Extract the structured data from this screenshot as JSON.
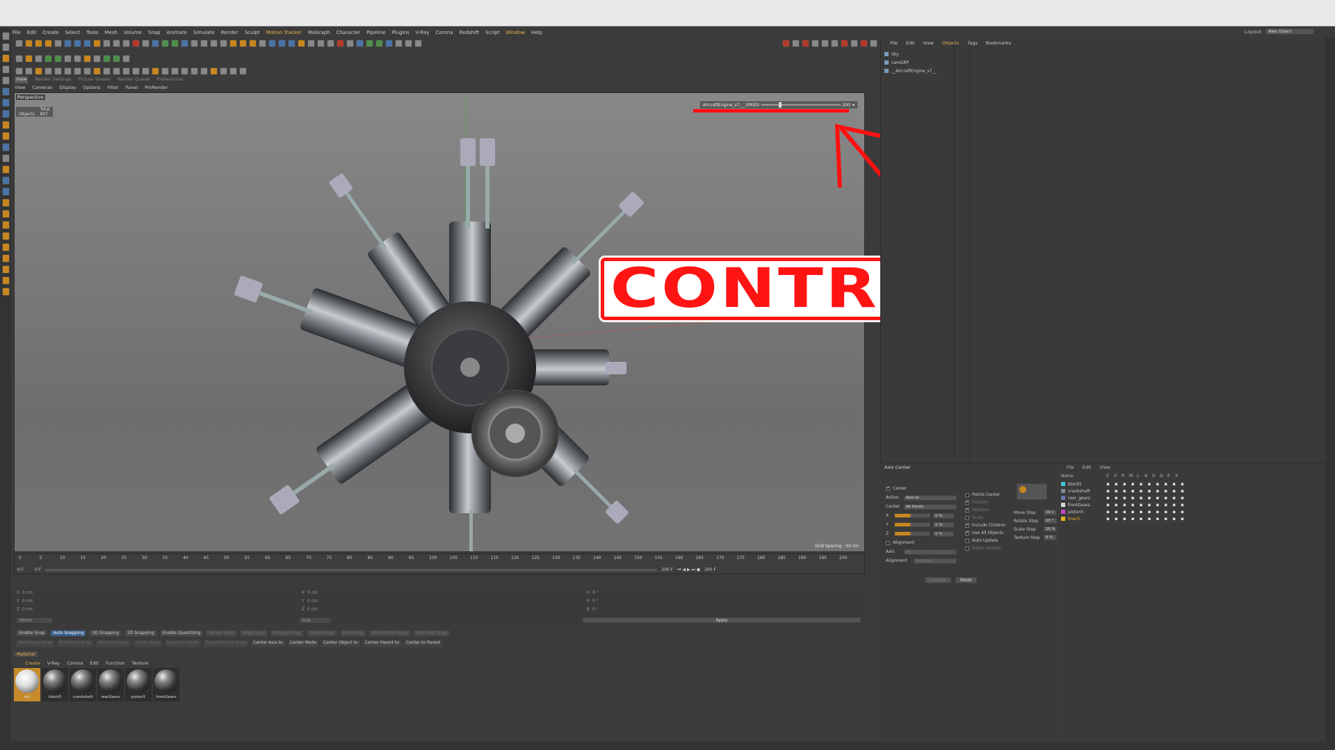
{
  "menu": [
    "File",
    "Edit",
    "Create",
    "Select",
    "Tools",
    "Mesh",
    "Volume",
    "Snap",
    "Animate",
    "Simulate",
    "Render",
    "Sculpt",
    "Motion Tracker",
    "MoGraph",
    "Character",
    "Pipeline",
    "Plugins",
    "V-Ray",
    "Corona",
    "Redshift",
    "Script",
    "Window",
    "Help"
  ],
  "layout": {
    "label": "Layout:",
    "value": "Alex (User)"
  },
  "panel_tabs": [
    "View",
    "Render Settings",
    "Picture Viewer",
    "Render Queue",
    "Preferences"
  ],
  "viewport_menu": [
    "View",
    "Cameras",
    "Display",
    "Options",
    "Filter",
    "Panel",
    "ProRender"
  ],
  "viewport": {
    "camera": "Perspective",
    "stats_header": "Total",
    "stats_label": "Objects",
    "stats_value": "807",
    "grid_spacing": "Grid Spacing : 50 cm"
  },
  "speed_control": {
    "label": "AircraftEngine_s7___SPEED",
    "value": "200"
  },
  "callout": {
    "text": "CONTROLL SPEED",
    "color": "#ff1414"
  },
  "timeline": {
    "ticks": [
      "0",
      "5",
      "10",
      "15",
      "20",
      "25",
      "30",
      "35",
      "40",
      "45",
      "50",
      "55",
      "60",
      "65",
      "70",
      "75",
      "80",
      "85",
      "90",
      "95",
      "100",
      "105",
      "110",
      "115",
      "120",
      "125",
      "130",
      "135",
      "140",
      "145",
      "150",
      "155",
      "160",
      "165",
      "170",
      "175",
      "180",
      "185",
      "190",
      "195",
      "200"
    ],
    "current_frame": "0 F",
    "start": "0 F",
    "end": "200 F",
    "end2": "200 F"
  },
  "coords": {
    "rows": [
      {
        "a": "X",
        "av": "0 cm",
        "b": "X",
        "bv": "0 cm",
        "c": "H",
        "cv": "0 °"
      },
      {
        "a": "Y",
        "av": "0 cm",
        "b": "Y",
        "bv": "0 cm",
        "c": "P",
        "cv": "0 °"
      },
      {
        "a": "Z",
        "av": "0 cm",
        "b": "Z",
        "bv": "0 cm",
        "c": "B",
        "cv": "0 °"
      }
    ],
    "mode1": "World",
    "mode2": "Size",
    "apply": "Apply"
  },
  "snap1": [
    {
      "t": "Enable Snap",
      "s": ""
    },
    {
      "t": "Auto Snapping",
      "s": "on"
    },
    {
      "t": "3D Snapping",
      "s": ""
    },
    {
      "t": "2D Snapping",
      "s": ""
    },
    {
      "t": "Enable Quantizing",
      "s": ""
    },
    {
      "t": "Vertex Snap",
      "s": "dim"
    },
    {
      "t": "Edge Snap",
      "s": "dim"
    },
    {
      "t": "Polygon Snap",
      "s": "dim"
    },
    {
      "t": "Spline Snap",
      "s": "dim"
    },
    {
      "t": "Axis Snap",
      "s": "dim"
    },
    {
      "t": "Intersection Snap",
      "s": "dim"
    },
    {
      "t": "Mid Point Snap",
      "s": "dim"
    }
  ],
  "snap2": [
    {
      "t": "Workplane Snap",
      "s": "dim"
    },
    {
      "t": "Grid Point Snap",
      "s": "dim"
    },
    {
      "t": "Grid Line Snap",
      "s": "dim"
    },
    {
      "t": "Guide Snap",
      "s": "dim"
    },
    {
      "t": "Dynamic Guide",
      "s": "dim"
    },
    {
      "t": "Perpendicular Snap",
      "s": "dim"
    },
    {
      "t": "Center Axis to",
      "s": ""
    },
    {
      "t": "Center Mode",
      "s": ""
    },
    {
      "t": "Center Object to",
      "s": ""
    },
    {
      "t": "Center Parent to",
      "s": ""
    },
    {
      "t": "Center to Parent",
      "s": ""
    }
  ],
  "material_tab": "Material",
  "material_menu": [
    "Create",
    "V-Ray",
    "Corona",
    "Edit",
    "Function",
    "Texture"
  ],
  "materials": [
    "sky",
    "block5",
    "crankshaft",
    "rearGears",
    "piston5",
    "frontGears"
  ],
  "object_manager": {
    "menu": [
      "File",
      "Edit",
      "View",
      "Objects",
      "Tags",
      "Bookmarks"
    ],
    "objects": [
      "Sky",
      "camGRP",
      "__AircraftEngine_s7__"
    ]
  },
  "attributes": {
    "title": "Axis Center",
    "center": "Center",
    "action_label": "Action",
    "action_value": "Axis to",
    "center_label": "Center",
    "center_value": "All Points",
    "axes": [
      {
        "n": "X",
        "v": "0 %"
      },
      {
        "n": "Y",
        "v": "0 %"
      },
      {
        "n": "Z",
        "v": "0 %"
      }
    ],
    "alignment": "Alignment",
    "axis_label": "Axis",
    "axis_value": "All",
    "alignment_label": "Alignment",
    "alignment_value": "Normals",
    "mid_opts": [
      {
        "t": "Points Center",
        "on": false
      },
      {
        "t": "Position",
        "on": true
      },
      {
        "t": "Rotation",
        "on": true
      },
      {
        "t": "Scale",
        "on": false
      },
      {
        "t": "Include Children",
        "on": true
      },
      {
        "t": "Use All Objects",
        "on": true
      },
      {
        "t": "Auto Update",
        "on": false
      },
      {
        "t": "Editor Update",
        "on": false
      }
    ],
    "steps": [
      {
        "n": "Move Step",
        "v": "10 c"
      },
      {
        "n": "Rotate Step",
        "v": "10 °"
      },
      {
        "n": "Scale Step",
        "v": "10 %"
      },
      {
        "n": "Texture Step",
        "v": "0 %"
      }
    ],
    "execute": "Execute",
    "reset": "Reset"
  },
  "layers": {
    "menu": [
      "File",
      "Edit",
      "View"
    ],
    "header_name": "Name",
    "header_flags": [
      "S",
      "V",
      "R",
      "M",
      "L",
      "A",
      "G",
      "D",
      "E",
      "X"
    ],
    "items": [
      {
        "name": "block5",
        "color": "#3fc6d8"
      },
      {
        "name": "crankshaft",
        "color": "#7a8a96"
      },
      {
        "name": "rear_gears",
        "color": "#6a7aa8"
      },
      {
        "name": "frontGears",
        "color": "#d8d8d8"
      },
      {
        "name": "piston5",
        "color": "#c844c8"
      },
      {
        "name": "liner5",
        "color": "#e6b820"
      }
    ]
  }
}
